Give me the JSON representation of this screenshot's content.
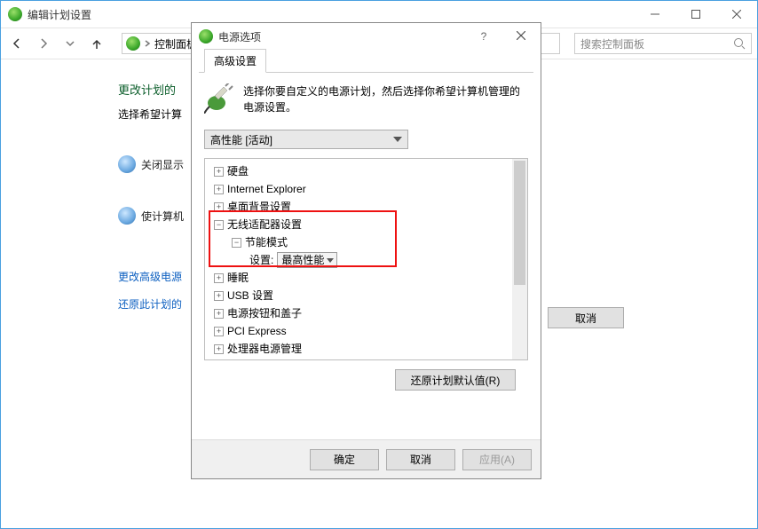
{
  "main": {
    "title": "编辑计划设置",
    "breadcrumb_root": "控制面板",
    "search_placeholder": "搜索控制面板",
    "heading": "更改计划的",
    "subheading": "选择希望计算",
    "side": {
      "item1": "关闭显示",
      "item2": "使计算机"
    },
    "link_advanced": "更改高级电源",
    "link_restore": "还原此计划的",
    "cancel_label": "取消"
  },
  "modal": {
    "title": "电源选项",
    "tab_label": "高级设置",
    "intro": "选择你要自定义的电源计划，然后选择你希望计算机管理的电源设置。",
    "plan_selected": "高性能 [活动]",
    "tree": {
      "hard_disk": "硬盘",
      "ie": "Internet Explorer",
      "desktop_bg": "桌面背景设置",
      "wireless": "无线适配器设置",
      "power_mode": "节能模式",
      "setting_label": "设置:",
      "setting_value": "最高性能",
      "sleep": "睡眠",
      "usb": "USB 设置",
      "power_button": "电源按钮和盖子",
      "pci": "PCI Express",
      "processor": "处理器电源管理"
    },
    "restore_defaults": "还原计划默认值(R)",
    "ok": "确定",
    "cancel": "取消",
    "apply": "应用(A)"
  }
}
